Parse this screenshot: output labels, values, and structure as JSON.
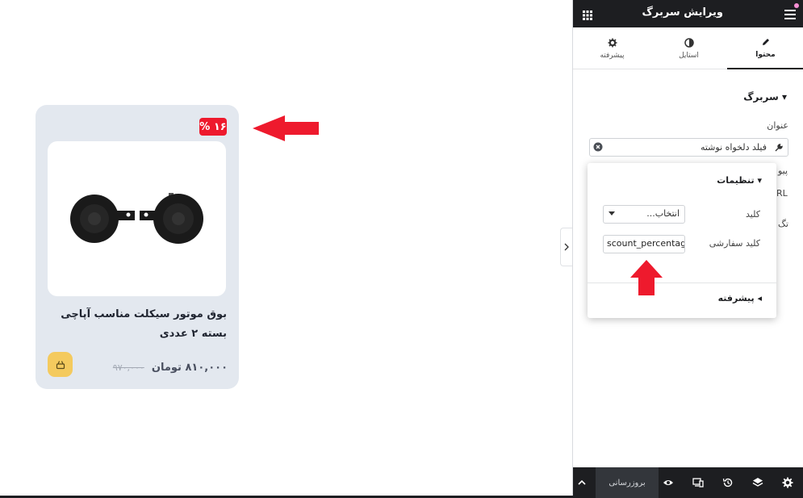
{
  "canvas": {
    "product_card": {
      "discount_badge": "۱۶ %",
      "image_alt": "horn-product-image",
      "title": "بوق موتور سیکلت مناسب آپاچی بسته ۲ عددی",
      "price": "۸۱۰,۰۰۰ تومان",
      "old_price": "۹۷۰,۰۰۰"
    }
  },
  "panel": {
    "header_title": "ویرایش سربرگ",
    "tabs": [
      {
        "label": "محتوا",
        "icon": "pencil-icon",
        "active": true
      },
      {
        "label": "استایل",
        "icon": "contrast-icon",
        "active": false
      },
      {
        "label": "پیشرفته",
        "icon": "gear-icon",
        "active": false
      }
    ],
    "section_title": "سربرگ",
    "title_label": "عنوان",
    "title_value": "فیلد دلخواه نوشته",
    "hidden_label_1": "پیو",
    "hidden_input_text": "RL",
    "hidden_label_2": "تگ"
  },
  "popup": {
    "title": "تنظیمات",
    "key_label": "کلید",
    "key_select_value": "انتخاب...",
    "custom_key_label": "کلید سفارشی",
    "custom_key_value": "scount_percentage",
    "advanced_label": "پیشرفته"
  },
  "footer": {
    "update_button": "بروزرسانی"
  },
  "colors": {
    "accent_red": "#ee1a2d",
    "dark": "#1d1e21",
    "cart_yellow": "#f4ca5e",
    "card_bg": "#e3e8ef"
  }
}
